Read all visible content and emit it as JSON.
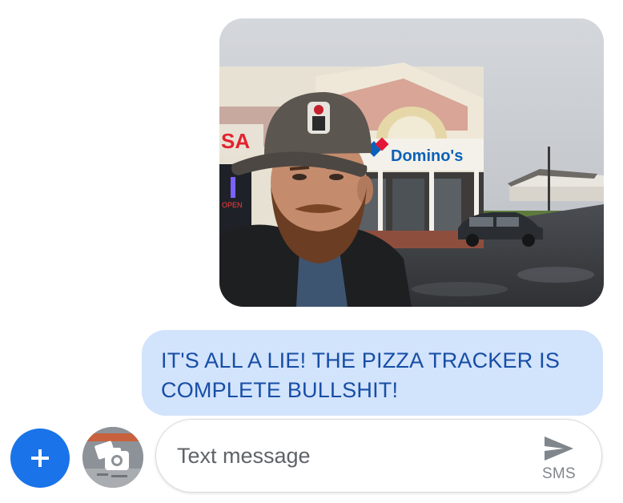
{
  "conversation": {
    "photo_message": {
      "storefront_sign": "Domino's",
      "side_sign_partial": "SA",
      "window_sign": "OPEN",
      "icon": "selfie-photo-image"
    },
    "text_message": {
      "text": "IT'S ALL A LIE! THE PIZZA TRACKER IS COMPLETE BULLSHIT!",
      "bubble_color": "#d2e3fc",
      "text_color": "#174ea6"
    }
  },
  "compose": {
    "add_icon": "plus-icon",
    "gallery_icon": "camera-gallery-icon",
    "placeholder": "Text message",
    "value": "",
    "send_icon": "send-icon",
    "send_label": "SMS",
    "accent_color": "#1a73e8"
  }
}
